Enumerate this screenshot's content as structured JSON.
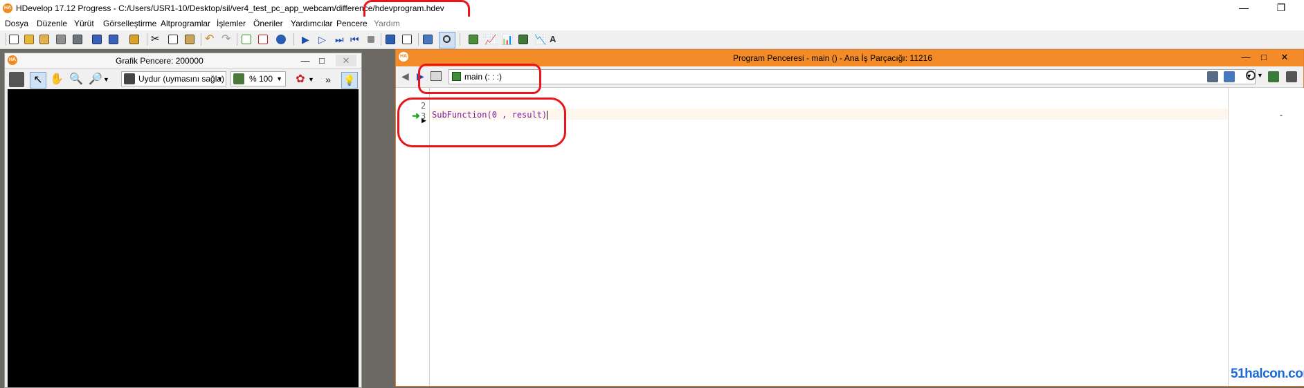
{
  "app": {
    "logo_text": "HA",
    "title": "HDevelop 17.12 Progress - C:/Users/USR1-10/Desktop/sil/ver4_test_pc_app_webcam/difference/hdevprogram.hdev",
    "minimize": "—",
    "restore": "❐"
  },
  "menu": {
    "items": [
      "Dosya",
      "Düzenle",
      "Yürüt",
      "Görselleştirme",
      "Altprogramlar",
      "İşlemler",
      "Öneriler",
      "Yardımcılar",
      "Pencere",
      "Yardım"
    ]
  },
  "graphics_window": {
    "title": "Grafik Pencere: 200000",
    "min": "—",
    "max": "□",
    "close": "✕",
    "fit_combo": "Uydur (uymasını sağla)",
    "zoom_combo": "% 100",
    "more": "»"
  },
  "program_window": {
    "title": "Program Penceresi - main () - Ana İş Parçacığı: 11216",
    "min": "—",
    "max": "□",
    "close": "✕",
    "procedure": "main (: : :)",
    "line_numbers": [
      "2",
      "3"
    ],
    "code_line": "SubFunction(0 , result)",
    "right_marker": "-"
  },
  "watermark": {
    "prefix": "51",
    "suffix": "halcon.com"
  },
  "colors": {
    "accent_orange": "#f28b28",
    "annotation_red": "#e8141b",
    "code_purple": "#7a1fa2",
    "pc_arrow_green": "#1aa51a"
  }
}
